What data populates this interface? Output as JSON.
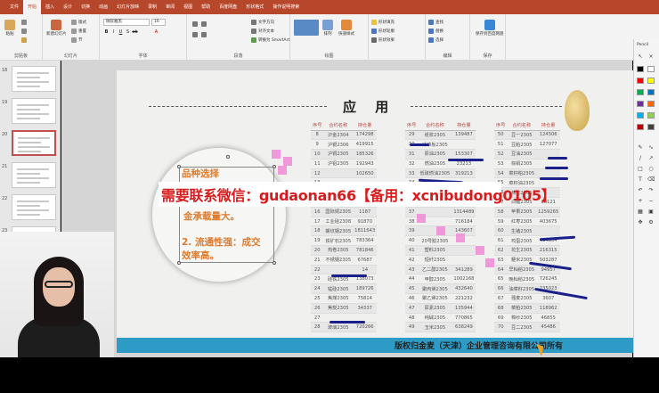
{
  "ribbon": {
    "tabs": [
      "文件",
      "开始",
      "插入",
      "设计",
      "切换",
      "动画",
      "幻灯片放映",
      "录制",
      "审阅",
      "视图",
      "帮助",
      "百度网盘",
      "形状格式",
      "操作说明搜索"
    ],
    "active_tab": "开始",
    "groups": {
      "clipboard": "剪贴板",
      "slides": "幻灯片",
      "font": "字体",
      "paragraph": "段落",
      "drawing": "绘图",
      "editing": "编辑",
      "save": "保存"
    },
    "buttons": {
      "paste": "粘贴",
      "new_slide": "新建幻灯片",
      "reuse": "重用幻灯片",
      "layout": "版式",
      "reset": "重置",
      "section": "节",
      "text_direction": "文字方向",
      "align_text": "对齐文本",
      "smartart": "转换为 SmartArt",
      "arrange": "排列",
      "quick_styles": "快速样式",
      "shape_fill": "形状填充",
      "shape_outline": "形状轮廓",
      "shape_effects": "形状效果",
      "find": "查找",
      "replace": "替换",
      "select": "选择",
      "baidu_save": "保存到百度网盘"
    },
    "font_name": "微软雅黑",
    "font_size": "16"
  },
  "thumbnails": {
    "numbers": [
      "18",
      "19",
      "20",
      "21",
      "22",
      "23",
      "24",
      "25",
      "26"
    ],
    "selected": "20"
  },
  "slide": {
    "title": "应 用",
    "copyright": "版权归金麦（天津）企业管理咨询有限公司所有",
    "callout_lines": [
      "品种选择",
      "金承载量大。",
      "2. 流通性强：成交",
      "效率高。"
    ]
  },
  "tables": [
    {
      "headers": [
        "序号",
        "合约名称",
        "持仓量"
      ],
      "rows": [
        [
          "8",
          "沪金2304",
          "174298"
        ],
        [
          "9",
          "沪银2306",
          "419915"
        ],
        [
          "10",
          "沪铜2305",
          "185326"
        ],
        [
          "11",
          "沪铝2305",
          "192943"
        ],
        [
          "12",
          "",
          "102650"
        ],
        [
          "13",
          "",
          ""
        ],
        [
          "14",
          "",
          ""
        ],
        [
          "15",
          "",
          ""
        ],
        [
          "16",
          "国际铜2305",
          "1187"
        ],
        [
          "17",
          "工业硅2308",
          "91870"
        ],
        [
          "18",
          "螺纹钢2305",
          "1811643"
        ],
        [
          "19",
          "铁矿石2305",
          "783364"
        ],
        [
          "20",
          "热卷2305",
          "781846"
        ],
        [
          "21",
          "不锈钢2305",
          "67687"
        ],
        [
          "22",
          "",
          "14"
        ],
        [
          "23",
          "硅铁2305",
          "138073"
        ],
        [
          "24",
          "锰硅2305",
          "189726"
        ],
        [
          "25",
          "焦煤2305",
          "75814"
        ],
        [
          "26",
          "焦炭2305",
          "34337"
        ],
        [
          "27",
          "",
          ""
        ],
        [
          "28",
          "玻璃2305",
          "720266"
        ]
      ]
    },
    {
      "headers": [
        "序号",
        "合约名称",
        "持仓量"
      ],
      "rows": [
        [
          "29",
          "纸浆2305",
          "139487"
        ],
        [
          "30",
          "纤维板2305",
          ""
        ],
        [
          "31",
          "原油2305",
          "153307"
        ],
        [
          "32",
          "燃油2305",
          "23213"
        ],
        [
          "33",
          "低硫燃油2305",
          "319213"
        ],
        [
          "34",
          "",
          ""
        ],
        [
          "35",
          "",
          ""
        ],
        [
          "36",
          "",
          ""
        ],
        [
          "37",
          "",
          "1314489"
        ],
        [
          "38",
          "",
          "716184"
        ],
        [
          "39",
          "",
          "143607"
        ],
        [
          "40",
          "20号胶2305",
          ""
        ],
        [
          "41",
          "塑料2305",
          ""
        ],
        [
          "42",
          "短纤2305",
          ""
        ],
        [
          "43",
          "乙二醇2305",
          "341289"
        ],
        [
          "44",
          "甲醇2305",
          "1002168"
        ],
        [
          "45",
          "聚丙烯2305",
          "432640"
        ],
        [
          "46",
          "聚乙烯2305",
          "221232"
        ],
        [
          "47",
          "尿素2305",
          "135944"
        ],
        [
          "48",
          "纯碱2305",
          "770865"
        ],
        [
          "49",
          "玉米2305",
          "638249"
        ]
      ]
    },
    {
      "headers": [
        "序号",
        "合约名称",
        "持仓量"
      ],
      "rows": [
        [
          "50",
          "豆一2305",
          "124506"
        ],
        [
          "51",
          "豆粕2305",
          "127077"
        ],
        [
          "52",
          "豆油2305",
          ""
        ],
        [
          "53",
          "棕榈2305",
          ""
        ],
        [
          "54",
          "菜籽粕2305",
          ""
        ],
        [
          "55",
          "菜籽油2305",
          ""
        ],
        [
          "56",
          "棉花2305",
          ""
        ],
        [
          "57",
          "白糖2305",
          "30121"
        ],
        [
          "58",
          "苹果2305",
          "1259265"
        ],
        [
          "59",
          "红枣2305",
          "403675"
        ],
        [
          "60",
          "生猪2305",
          ""
        ],
        [
          "61",
          "鸡蛋2305",
          "494804"
        ],
        [
          "62",
          "花生2305",
          "216315"
        ],
        [
          "63",
          "粳米2305",
          "503287"
        ],
        [
          "64",
          "早籼稻2305",
          "94957"
        ],
        [
          "65",
          "晚籼稻2305",
          "726245"
        ],
        [
          "66",
          "油菜籽2305",
          "235023"
        ],
        [
          "67",
          "强麦2305",
          "3607"
        ],
        [
          "68",
          "菜粕2305",
          "118962"
        ],
        [
          "69",
          "棉纱2305",
          "46855"
        ],
        [
          "70",
          "豆二2305",
          "45486"
        ]
      ]
    }
  ],
  "watermark": "需要联系微信：gudaonan66【备用：xcnibudong0105】",
  "pen_toolbar": {
    "label": "Pencil",
    "colors": [
      "#000000",
      "#ffffff",
      "#ff0000",
      "#ffff00",
      "#00b050",
      "#0070c0",
      "#7030a0",
      "#ff6600",
      "#00b0f0",
      "#92d050",
      "#c00000",
      "#404040"
    ]
  }
}
